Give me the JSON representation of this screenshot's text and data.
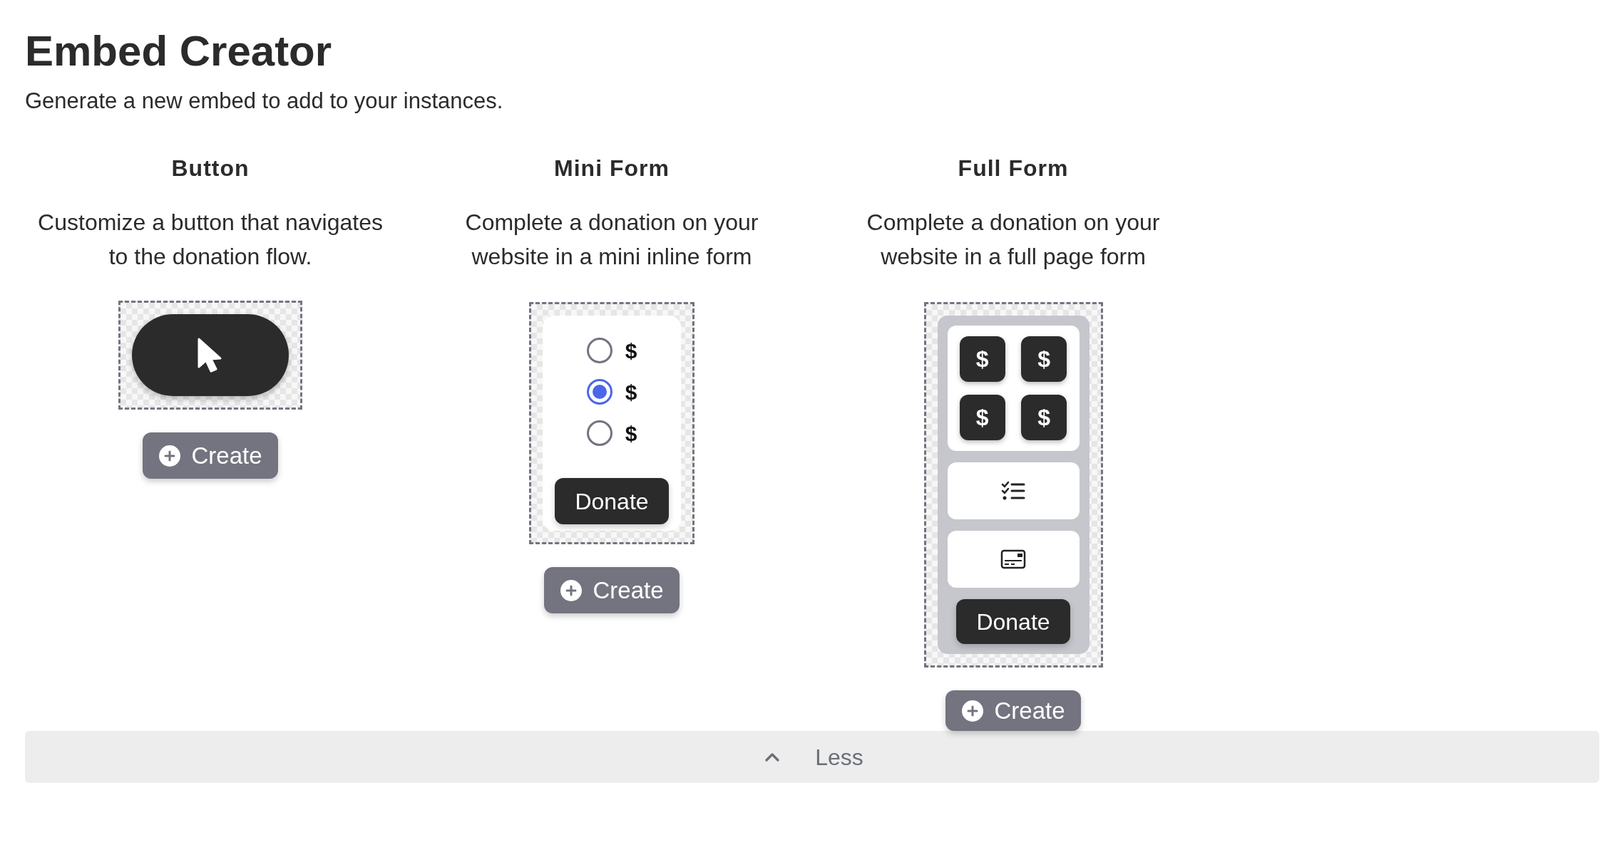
{
  "title": "Embed Creator",
  "subtitle": "Generate a new embed to add to your instances.",
  "embeds": [
    {
      "kind": "button",
      "heading": "Button",
      "description": "Customize a button that navigates to the donation flow.",
      "create": "Create"
    },
    {
      "kind": "mini_form",
      "heading": "Mini Form",
      "description": "Complete a donation on your website in a mini inline form",
      "options": [
        {
          "label": "$",
          "selected": false
        },
        {
          "label": "$",
          "selected": true
        },
        {
          "label": "$",
          "selected": false
        }
      ],
      "donate": "Donate",
      "create": "Create"
    },
    {
      "kind": "full_form",
      "heading": "Full Form",
      "description": "Complete a donation on your website in a full page form",
      "amounts": [
        "$",
        "$",
        "$",
        "$"
      ],
      "donate": "Donate",
      "create": "Create"
    }
  ],
  "toggle": {
    "label": "Less",
    "expanded": true
  }
}
